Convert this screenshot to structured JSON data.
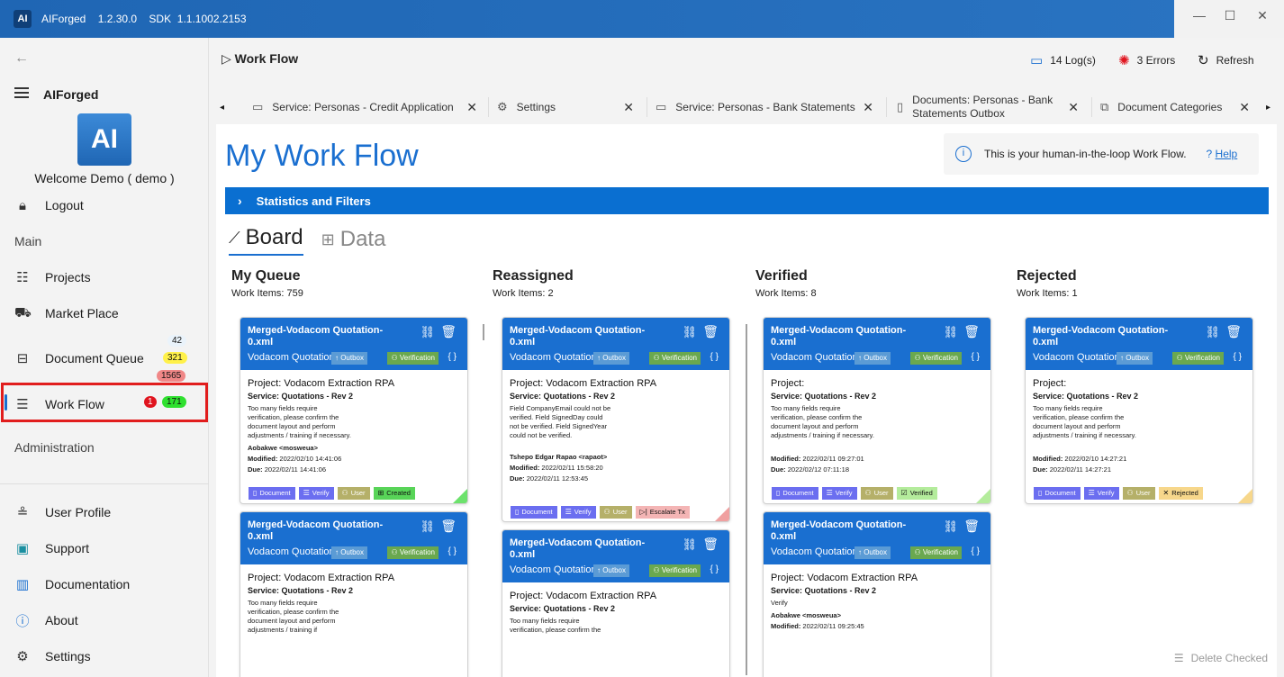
{
  "app": {
    "title": "AIForged",
    "version": "1.2.30.0",
    "sdk_label": "SDK",
    "sdk_version": "1.1.1002.2153",
    "icon_text": "AI"
  },
  "sidebar": {
    "brand": "AIForged",
    "welcome": "Welcome  Demo  ( demo )",
    "logout": "Logout",
    "section_main": "Main",
    "projects": "Projects",
    "market_place": "Market Place",
    "document_queue": "Document Queue",
    "work_flow": "Work Flow",
    "section_admin": "Administration",
    "user_profile": "User Profile",
    "support": "Support",
    "documentation": "Documentation",
    "about": "About",
    "settings": "Settings",
    "badges": {
      "dq_1": "42",
      "dq_2": "321",
      "dq_3": "1565",
      "wf_1": "1",
      "wf_2": "171"
    }
  },
  "header": {
    "breadcrumb": "Work Flow",
    "logs": "14 Log(s)",
    "errors": "3 Errors",
    "refresh": "Refresh"
  },
  "tabs": [
    {
      "label": "Service: Personas - Credit Application"
    },
    {
      "label": "Settings"
    },
    {
      "label": "Service: Personas - Bank Statements"
    },
    {
      "label": "Documents: Personas - Bank Statements Outbox"
    },
    {
      "label": "Document Categories"
    }
  ],
  "page": {
    "title": "My Work Flow",
    "info": "This is your human-in-the-loop Work Flow.",
    "help": "Help",
    "stats": "Statistics and Filters",
    "view_board": "Board",
    "view_data": "Data",
    "delete_checked": "Delete Checked"
  },
  "columns": [
    {
      "title": "My Queue",
      "count": "Work Items: 759"
    },
    {
      "title": "Reassigned",
      "count": "Work Items: 2"
    },
    {
      "title": "Verified",
      "count": "Work Items: 8"
    },
    {
      "title": "Rejected",
      "count": "Work Items: 1"
    }
  ],
  "card_common": {
    "title": "Merged-Vodacom Quotation-0.xml",
    "subtitle": "Vodacom Quotation",
    "outbox": "Outbox",
    "verification": "Verification",
    "braces": "{ }",
    "document": "Document",
    "verify": "Verify",
    "user": "User",
    "service": "Service: Quotations - Rev 2",
    "modified_label": "Modified:",
    "due_label": "Due:"
  },
  "cards": [
    {
      "project": "Project: Vodacom Extraction RPA",
      "msg": "Too many fields require verification, please confirm the document layout and perform adjustments / training if necessary.",
      "user": "Aobakwe <mosweua>",
      "modified": "2022/02/10 14:41:06",
      "due": "2022/02/11 14:41:06",
      "status": "Created"
    },
    {
      "project": "Project: Vodacom Extraction RPA",
      "msg": "Too many fields require verification, please confirm the document layout and perform adjustments / training if"
    },
    {
      "project": "Project: Vodacom Extraction RPA",
      "msg": "Field CompanyEmail could not be verified. Field SignedDay could not be verified. Field SignedYear could not be verified.",
      "user": "Tshepo Edgar Rapao <rapaot>",
      "modified": "2022/02/11 15:58:20",
      "due": "2022/02/11 12:53:45",
      "status": "Escalate Tx"
    },
    {
      "project": "Project: Vodacom Extraction RPA",
      "msg": "Too many fields require verification, please confirm the"
    },
    {
      "project": "Project:",
      "msg": "Too many fields require verification, please confirm the document layout and perform adjustments / training if necessary.",
      "modified": "2022/02/11 09:27:01",
      "due": "2022/02/12 07:11:18",
      "status": "Verified"
    },
    {
      "project": "Project: Vodacom Extraction RPA",
      "msg": "Verify",
      "user": "Aobakwe <mosweua>",
      "modified": "2022/02/11 09:25:45"
    },
    {
      "project": "Project:",
      "msg": "Too many fields require verification, please confirm the document layout and perform adjustments / training if necessary.",
      "modified": "2022/02/10 14:27:21",
      "due": "2022/02/11 14:27:21",
      "status": "Rejected"
    }
  ]
}
